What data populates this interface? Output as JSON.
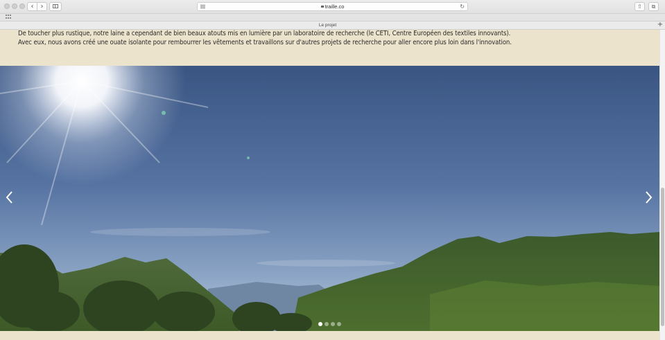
{
  "browser": {
    "url": "traille.co",
    "tab_title": "Le projet",
    "back_glyph": "‹",
    "forward_glyph": "›",
    "reload_glyph": "↻",
    "share_glyph": "⇧",
    "tabs_glyph": "⧉",
    "new_tab_glyph": "+"
  },
  "page": {
    "paragraphs": [
      "De toucher plus rustique, notre laine a cependant de bien beaux atouts mis en lumière par un laboratoire de recherche (le CETI, Centre Européen des textiles innovants).",
      "Avec eux, nous avons créé une ouate isolante pour rembourrer les vêtements et travaillons sur d'autres projets de recherche pour aller encore plus loin dans l'innovation."
    ],
    "background_color": "#ece3cc",
    "slider": {
      "image_subject": "mountain-landscape-with-sun",
      "slide_count": 4,
      "active_slide": 1,
      "prev_icon": "chevron-left-icon",
      "next_icon": "chevron-right-icon"
    }
  }
}
